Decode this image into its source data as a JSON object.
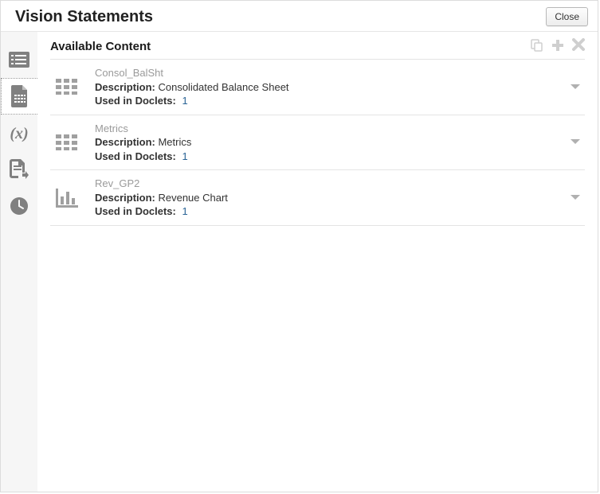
{
  "dialog": {
    "title": "Vision Statements",
    "close_label": "Close"
  },
  "panel": {
    "title": "Available Content"
  },
  "labels": {
    "description": "Description:",
    "used_in_doclets": "Used in Doclets:"
  },
  "items": [
    {
      "name": "Consol_BalSht",
      "description": "Consolidated Balance Sheet",
      "used_in_doclets": "1",
      "icon": "grid"
    },
    {
      "name": "Metrics",
      "description": "Metrics",
      "used_in_doclets": "1",
      "icon": "grid"
    },
    {
      "name": "Rev_GP2",
      "description": "Revenue Chart",
      "used_in_doclets": "1",
      "icon": "chart"
    }
  ]
}
